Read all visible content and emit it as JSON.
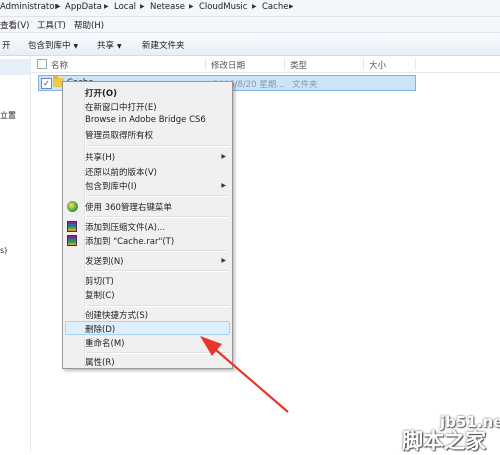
{
  "breadcrumb": {
    "items": [
      "Administrator",
      "AppData",
      "Local",
      "Netease",
      "CloudMusic",
      "Cache"
    ],
    "separator": "▶"
  },
  "menubar": {
    "items": [
      "查看(V)",
      "工具(T)",
      "帮助(H)"
    ]
  },
  "toolbar": {
    "open_partial": "开",
    "include_in_library": "包含到库中",
    "share": "共享",
    "new_folder": "新建文件夹"
  },
  "navpane": {
    "item_partial": "立置",
    "item_partial2": "s)"
  },
  "columns": {
    "name": "名称",
    "date_modified": "修改日期",
    "type": "类型",
    "size": "大小"
  },
  "file_row": {
    "name": "Cache",
    "date": "2016/8/20 星期...",
    "type": "文件夹",
    "checked": "✓"
  },
  "context_menu": {
    "open": "打开(O)",
    "open_new_window": "在新窗口中打开(E)",
    "browse_bridge": "Browse in Adobe Bridge CS6",
    "take_ownership": "管理员取得所有权",
    "share": "共享(H)",
    "restore_previous": "还原以前的版本(V)",
    "include_in_library": "包含到库中(I)",
    "use_360": "使用 360管理右键菜单",
    "add_to_archive": "添加到压缩文件(A)...",
    "add_to_rar": "添加到 \"Cache.rar\"(T)",
    "send_to": "发送到(N)",
    "cut": "剪切(T)",
    "copy": "复制(C)",
    "create_shortcut": "创建快捷方式(S)",
    "delete": "删除(D)",
    "rename": "重命名(M)",
    "properties": "属性(R)"
  },
  "watermark": {
    "site": "jb51.net",
    "brand": "脚本之家"
  },
  "colors": {
    "arrow": "#e8362e",
    "selection": "#cce4f9",
    "menu_bg": "#f0f0f0"
  }
}
